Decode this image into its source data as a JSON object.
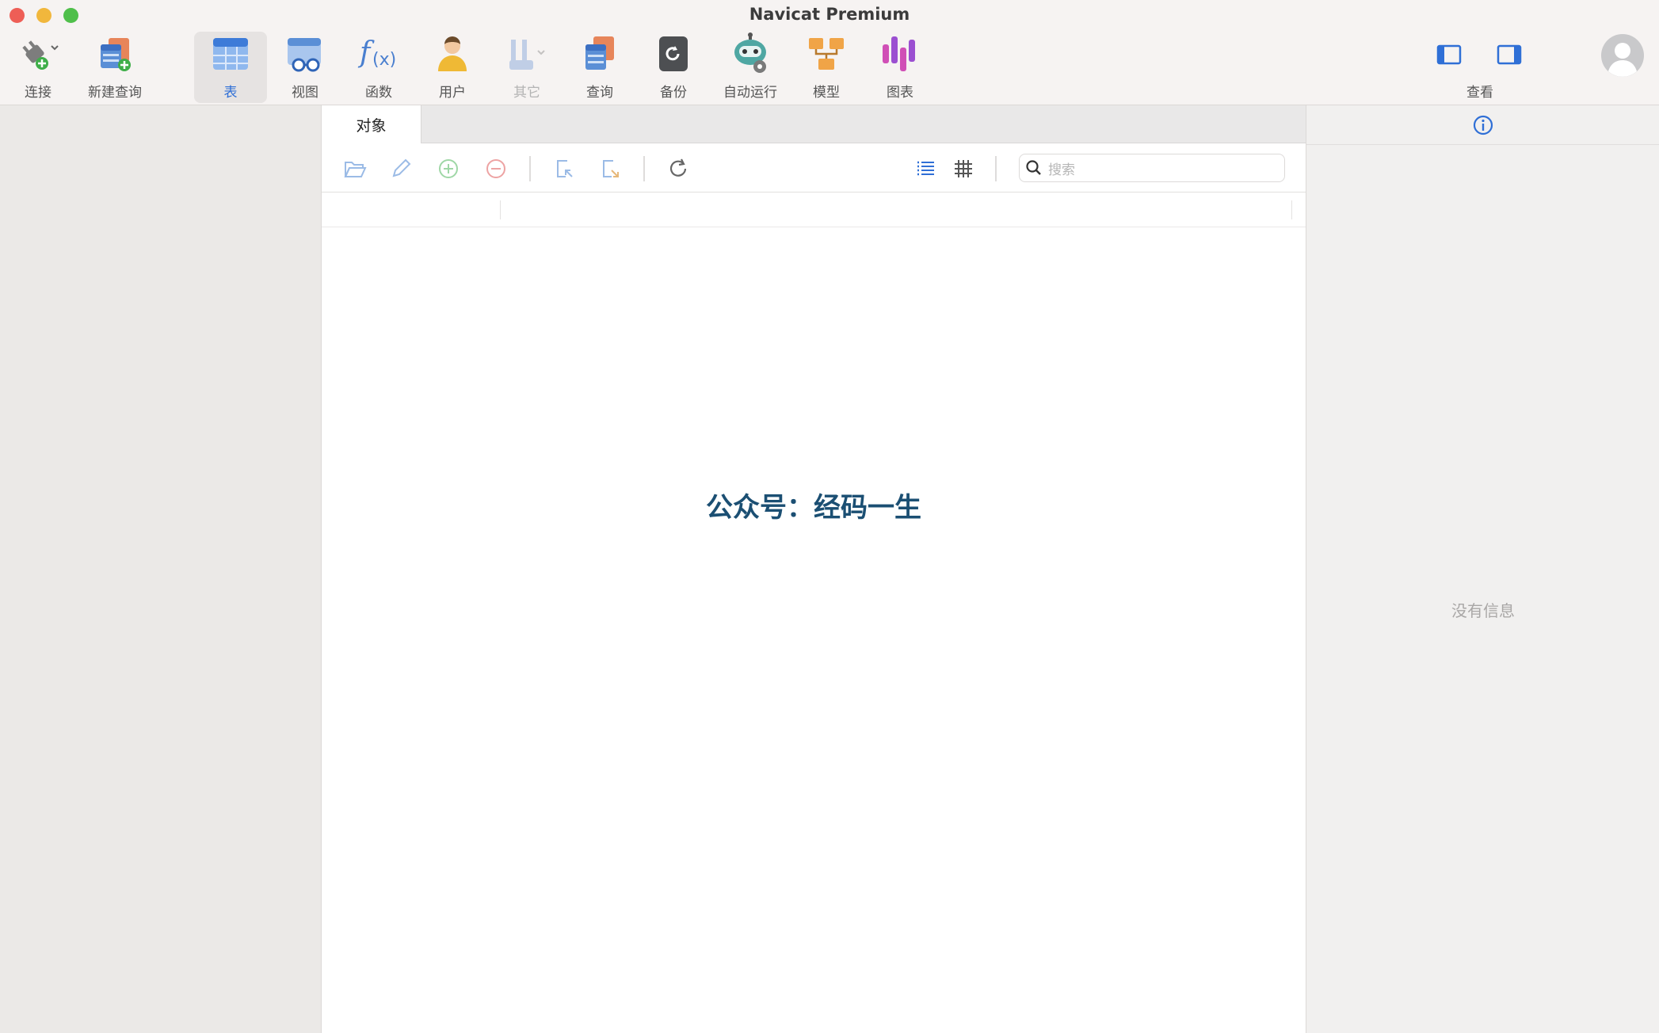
{
  "window": {
    "title": "Navicat Premium"
  },
  "toolbar": {
    "items": [
      {
        "key": "connect",
        "label": "连接",
        "icon": "plug-icon"
      },
      {
        "key": "new_query",
        "label": "新建查询",
        "icon": "new-query-icon"
      },
      {
        "key": "table",
        "label": "表",
        "icon": "table-icon",
        "active": true
      },
      {
        "key": "view",
        "label": "视图",
        "icon": "view-icon"
      },
      {
        "key": "function",
        "label": "函数",
        "icon": "function-icon"
      },
      {
        "key": "user",
        "label": "用户",
        "icon": "user-icon"
      },
      {
        "key": "other",
        "label": "其它",
        "icon": "tools-icon",
        "disabled": true
      },
      {
        "key": "query",
        "label": "查询",
        "icon": "query-icon"
      },
      {
        "key": "backup",
        "label": "备份",
        "icon": "backup-icon"
      },
      {
        "key": "automation",
        "label": "自动运行",
        "icon": "robot-icon"
      },
      {
        "key": "model",
        "label": "模型",
        "icon": "model-icon"
      },
      {
        "key": "chart",
        "label": "图表",
        "icon": "chart-icon"
      }
    ],
    "view_label": "查看"
  },
  "object_panel": {
    "tab_label": "对象",
    "search_placeholder": "搜索",
    "watermark": "公众号：经码一生"
  },
  "info_panel": {
    "empty_text": "没有信息"
  },
  "colors": {
    "accent": "#2f6fd6",
    "watermark": "#1b4f73"
  }
}
